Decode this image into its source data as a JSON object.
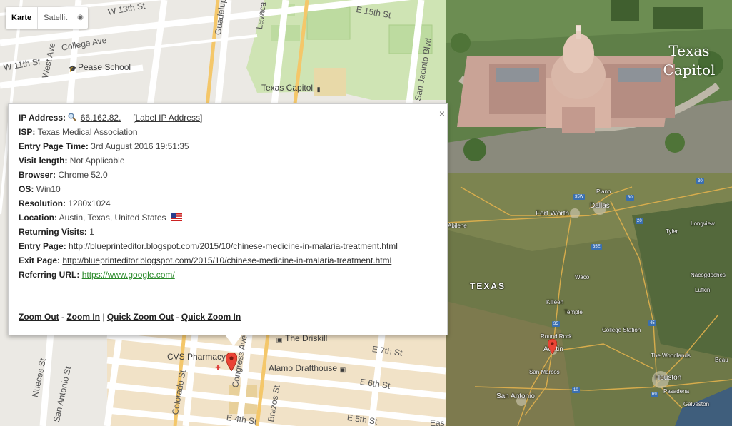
{
  "map_type": {
    "map_label": "Karte",
    "satellite_label": "Satellit"
  },
  "street_map": {
    "pois": [
      {
        "name": "Pease School"
      },
      {
        "name": "Texas Capitol"
      },
      {
        "name": "The Driskill"
      },
      {
        "name": "CVS Pharmacy"
      },
      {
        "name": "Alamo Drafthouse"
      }
    ],
    "streets": [
      "W 13th St",
      "College Ave",
      "W 11th St",
      "West Ave",
      "Guadalupe St",
      "Lavaca St",
      "E 15th St",
      "San Jacinto Blvd",
      "Nueces St",
      "San Antonio St",
      "Colorado St",
      "Congress Ave",
      "E 7th St",
      "E 6th St",
      "E 5th St",
      "E 4th St",
      "Brazos St",
      "Eas"
    ]
  },
  "info": {
    "ip_label": "IP Address:",
    "ip_value": "66.162.82.",
    "label_ip_link": "[Label IP Address]",
    "fields": [
      {
        "label": "ISP:",
        "value": "Texas Medical Association"
      },
      {
        "label": "Entry Page Time:",
        "value": "3rd August 2016 19:51:35"
      },
      {
        "label": "Visit length:",
        "value": "Not Applicable"
      },
      {
        "label": "Browser:",
        "value": "Chrome 52.0"
      },
      {
        "label": "OS:",
        "value": "Win10"
      },
      {
        "label": "Resolution:",
        "value": "1280x1024"
      },
      {
        "label": "Location:",
        "value": "Austin, Texas, United States"
      },
      {
        "label": "Returning Visits:",
        "value": "1"
      }
    ],
    "entry_page_label": "Entry Page:",
    "entry_page_url": "http://blueprinteditor.blogspot.com/2015/10/chinese-medicine-in-malaria-treatment.html",
    "exit_page_label": "Exit Page:",
    "exit_page_url": "http://blueprinteditor.blogspot.com/2015/10/chinese-medicine-in-malaria-treatment.html",
    "referring_label": "Referring URL:",
    "referring_url": "https://www.google.com/",
    "zoom_out": "Zoom Out",
    "zoom_in": "Zoom In",
    "quick_zoom_out": "Quick Zoom Out",
    "quick_zoom_in": "Quick Zoom In",
    "sep_dash": "-",
    "sep_pipe": "|",
    "close_glyph": "×"
  },
  "capitol_photo": {
    "title_line1": "Texas",
    "title_line2": "Capitol"
  },
  "texas_map": {
    "state_label": "TEXAS",
    "cities": [
      "Plano",
      "Dallas",
      "Fort Worth",
      "Abilene",
      "Tyler",
      "Longview",
      "Waco",
      "Nacogdoches",
      "Lufkin",
      "Killeen",
      "Temple",
      "Round Rock",
      "Austin",
      "College Station",
      "The Woodlands",
      "Houston",
      "Pasadena",
      "San Marcos",
      "San Antonio",
      "Galveston",
      "Beau"
    ],
    "highways": [
      "35W",
      "35E",
      "30",
      "20",
      "35",
      "45",
      "10",
      "69",
      "30"
    ]
  }
}
